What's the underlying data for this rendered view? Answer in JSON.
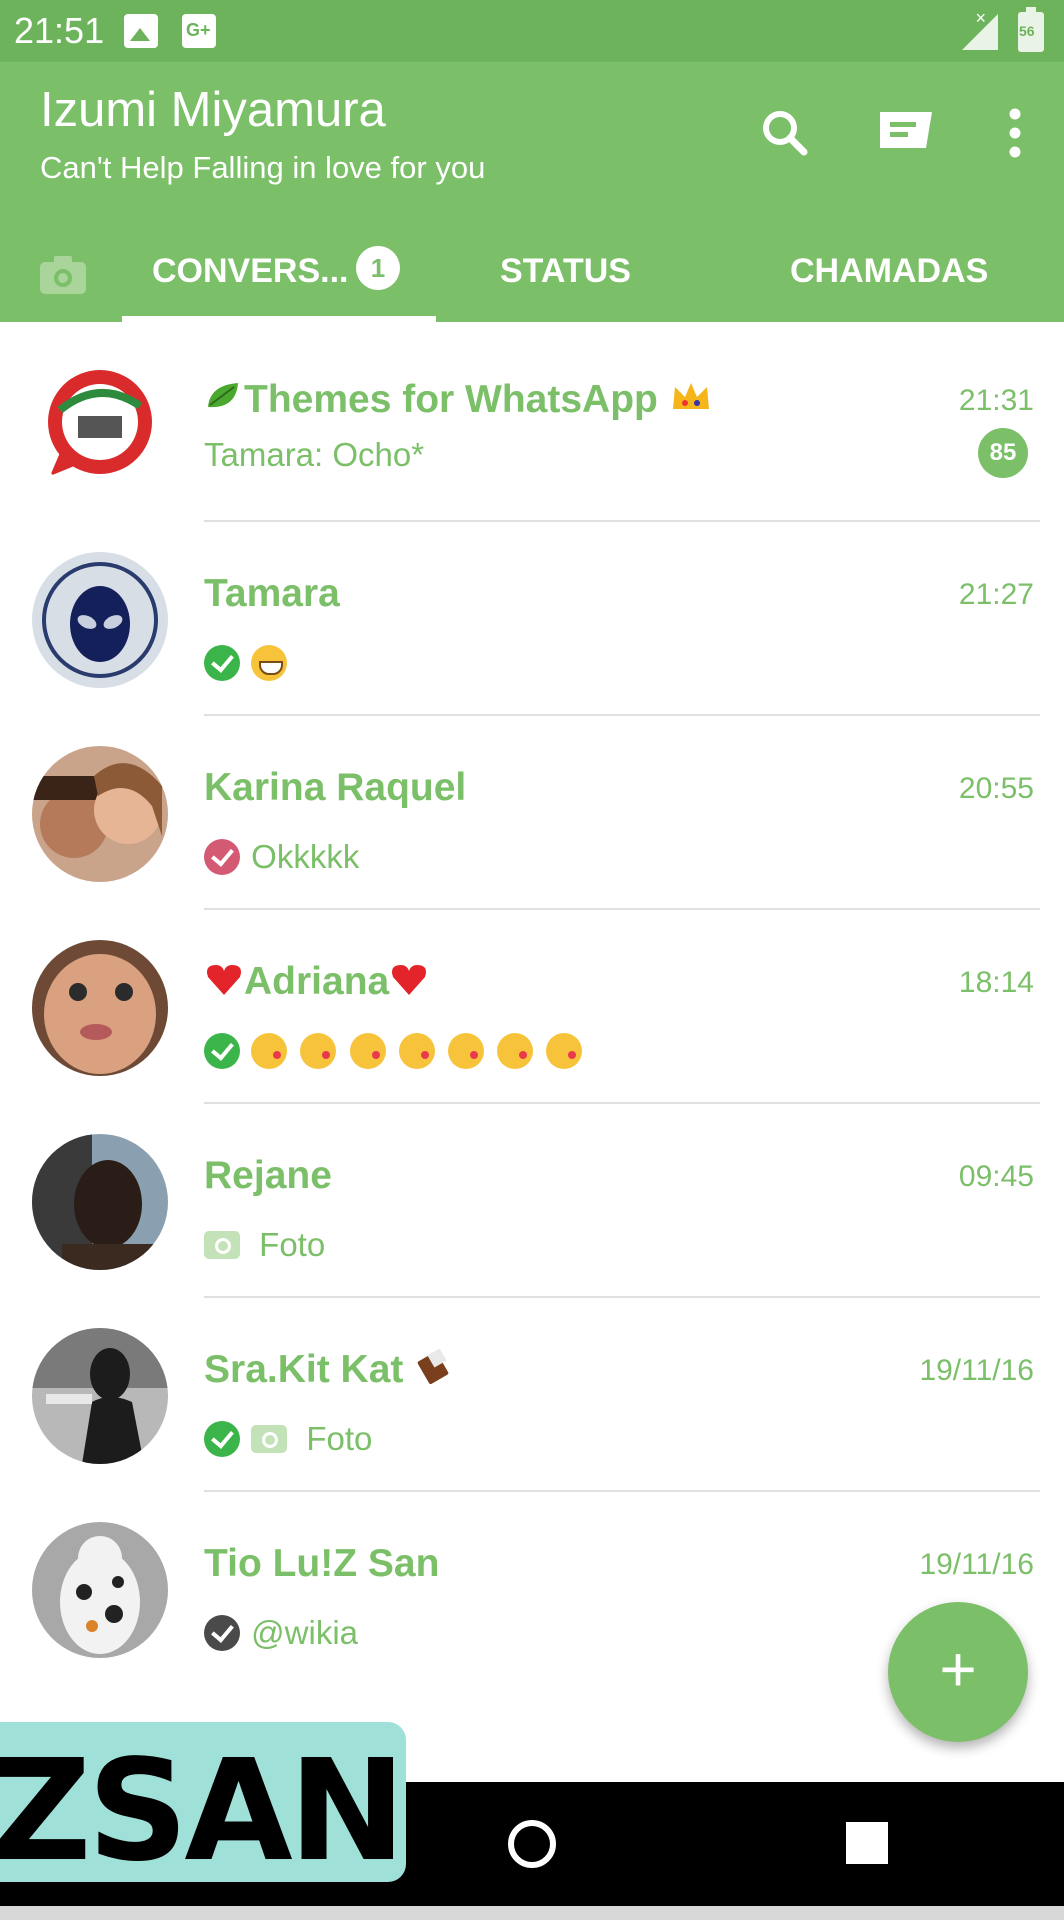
{
  "status_bar": {
    "time": "21:51",
    "battery_text": "56",
    "icons": [
      "image-icon",
      "google-plus-icon",
      "signal-icon",
      "battery-icon"
    ]
  },
  "header": {
    "title": "Izumi Miyamura",
    "subtitle": "Can't Help Falling in love for you",
    "actions": [
      "search-icon",
      "new-chat-icon",
      "more-options-icon"
    ]
  },
  "tabs": {
    "camera_icon": "camera-icon",
    "chats": {
      "label": "CONVERS...",
      "badge": "1"
    },
    "status": {
      "label": "STATUS"
    },
    "calls": {
      "label": "CHAMADAS"
    }
  },
  "chats": [
    {
      "name": "Themes for WhatsApp",
      "time": "21:31",
      "preview": "Tamara: Ocho*",
      "unread": "85"
    },
    {
      "name": "Tamara",
      "time": "21:27",
      "preview": ""
    },
    {
      "name": "Karina Raquel",
      "time": "20:55",
      "preview": "Okkkkk"
    },
    {
      "name": "Adriana",
      "time": "18:14",
      "preview": ""
    },
    {
      "name": "Rejane",
      "time": "09:45",
      "preview": "Foto"
    },
    {
      "name": "Sra.Kit Kat",
      "time": "19/11/16",
      "preview": "Foto"
    },
    {
      "name": "Tio Lu!Z San",
      "time": "19/11/16",
      "preview": "@wikia"
    }
  ],
  "fab": {
    "label": "+"
  },
  "watermark": {
    "text": "ZSAN_"
  },
  "colors": {
    "accent": "#7bbf68",
    "status_bar": "#6db35c",
    "read_check": "#3bb54a",
    "pink_check": "#d45a74",
    "dark_check": "#4a4a4a"
  }
}
